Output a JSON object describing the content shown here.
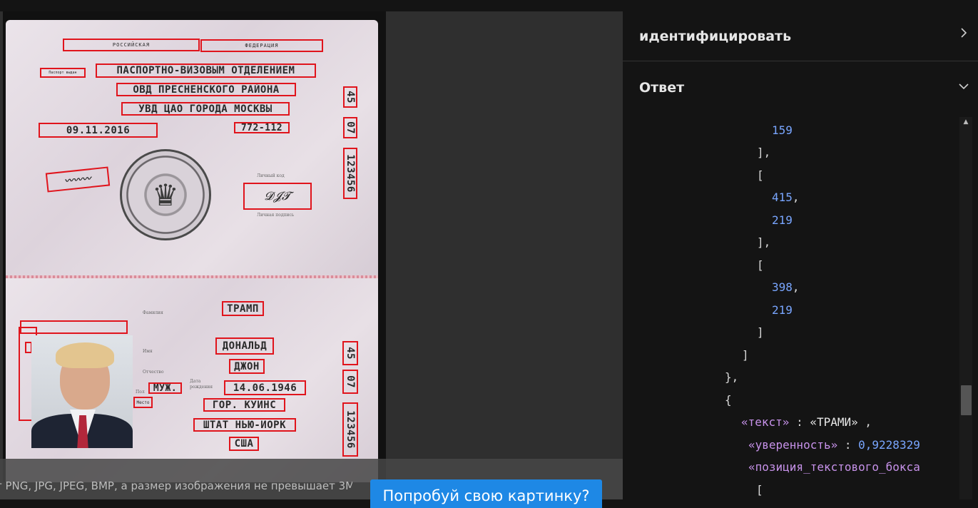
{
  "passport": {
    "country_left": "РОССИЙСКАЯ",
    "country_right": "ФЕДЕРАЦИЯ",
    "issued_by_label": "Паспорт выдан",
    "issuer_line1": "ПАСПОРТНО-ВИЗОВЫМ ОТДЕЛЕНИЕМ",
    "issuer_line2": "ОВД ПРЕСНЕНСКОГО РАЙОНА",
    "issuer_line3": "УВД ЦАО ГОРОДА МОСКВЫ",
    "issue_date": "09.11.2016",
    "dept_code": "772-112",
    "series_part1": "45",
    "series_part2": "07",
    "number": "123456",
    "signature_label": "Личная подпись",
    "personal_code_label": "Личный код",
    "surname_label": "Фамилия",
    "surname": "ТРАМП",
    "name_label": "Имя",
    "name": "ДОНАЛЬД",
    "patronymic_label": "Отчество",
    "patronymic": "ДЖОН",
    "sex_label": "Пол",
    "sex": "МУЖ.",
    "dob_label": "Дата рождения",
    "dob": "14.06.1946",
    "pob_label": "Место",
    "pob_line1": "ГОР. КУИНС",
    "pob_line2": "ШТАТ НЬЮ-ИОРК",
    "pob_line3": "США"
  },
  "overlay": {
    "hint": "т PNG, JPG, JPEG, BMP, а размер изображения не превышает 3M",
    "try_button": "Попробуй свою картинку?"
  },
  "panel": {
    "identify_title": "идентифицировать",
    "answer_title": "Ответ"
  },
  "json_view": {
    "v159": "159",
    "v415": "415",
    "v219a": "219",
    "v398": "398",
    "v219b": "219",
    "key_text": "«текст»",
    "val_text": "«ТРАМИ»",
    "key_conf": "«уверенность»",
    "val_conf": "0,9228329",
    "key_box": "«позиция_текстового_бокса"
  }
}
